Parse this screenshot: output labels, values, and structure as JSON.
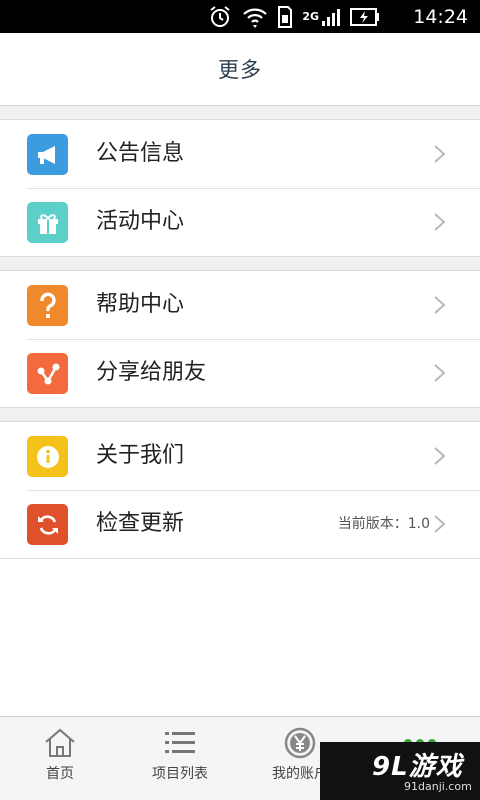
{
  "status_bar": {
    "network": "2G",
    "time": "14:24",
    "icons": [
      "alarm-icon",
      "wifi-icon",
      "sim-icon",
      "signal-icon",
      "battery-icon"
    ]
  },
  "header": {
    "title": "更多"
  },
  "groups": [
    {
      "items": [
        {
          "label": "公告信息",
          "icon": "megaphone-icon",
          "color": "#3d9be0"
        },
        {
          "label": "活动中心",
          "icon": "gift-icon",
          "color": "#5ccfc9"
        }
      ]
    },
    {
      "items": [
        {
          "label": "帮助中心",
          "icon": "question-icon",
          "color": "#f0892c"
        },
        {
          "label": "分享给朋友",
          "icon": "share-icon",
          "color": "#f26a3d"
        }
      ]
    },
    {
      "items": [
        {
          "label": "关于我们",
          "icon": "info-icon",
          "color": "#f4c21b"
        },
        {
          "label": "检查更新",
          "icon": "refresh-icon",
          "color": "#e0502a",
          "extra": "当前版本：1.0"
        }
      ]
    }
  ],
  "tab_bar": {
    "tabs": [
      {
        "label": "首页",
        "icon": "home-icon"
      },
      {
        "label": "项目列表",
        "icon": "list-icon"
      },
      {
        "label": "我的账户",
        "icon": "yen-coin-icon"
      },
      {
        "label": "",
        "icon": "more-dots-icon",
        "active_color": "#3aa635"
      }
    ]
  },
  "watermark": {
    "logo": "9L游戏",
    "url": "91danji.com"
  }
}
